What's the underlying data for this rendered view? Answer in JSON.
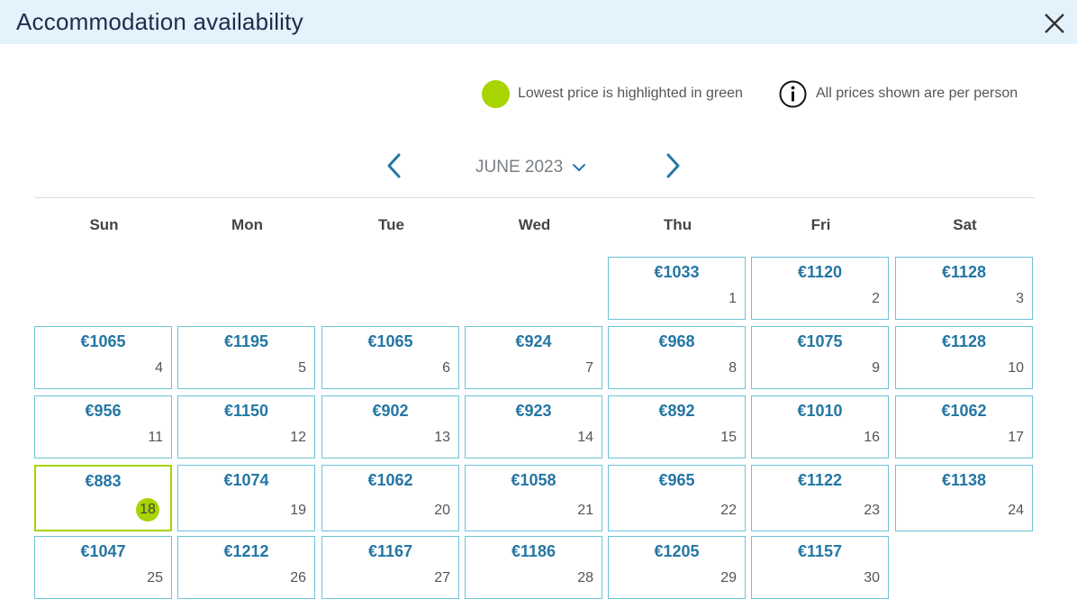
{
  "header": {
    "title": "Accommodation availability"
  },
  "legend": {
    "lowest_label": "Lowest price is highlighted in green",
    "info_label": "All prices shown are per person",
    "highlight_color": "#a8d400"
  },
  "calendar": {
    "month_label": "JUNE 2023",
    "weekdays": [
      "Sun",
      "Mon",
      "Tue",
      "Wed",
      "Thu",
      "Fri",
      "Sat"
    ],
    "first_weekday_index": 4,
    "lowest_day": 18,
    "days": [
      {
        "day": "1",
        "price": "€1033"
      },
      {
        "day": "2",
        "price": "€1120"
      },
      {
        "day": "3",
        "price": "€1128"
      },
      {
        "day": "4",
        "price": "€1065"
      },
      {
        "day": "5",
        "price": "€1195"
      },
      {
        "day": "6",
        "price": "€1065"
      },
      {
        "day": "7",
        "price": "€924"
      },
      {
        "day": "8",
        "price": "€968"
      },
      {
        "day": "9",
        "price": "€1075"
      },
      {
        "day": "10",
        "price": "€1128"
      },
      {
        "day": "11",
        "price": "€956"
      },
      {
        "day": "12",
        "price": "€1150"
      },
      {
        "day": "13",
        "price": "€902"
      },
      {
        "day": "14",
        "price": "€923"
      },
      {
        "day": "15",
        "price": "€892"
      },
      {
        "day": "16",
        "price": "€1010"
      },
      {
        "day": "17",
        "price": "€1062"
      },
      {
        "day": "18",
        "price": "€883"
      },
      {
        "day": "19",
        "price": "€1074"
      },
      {
        "day": "20",
        "price": "€1062"
      },
      {
        "day": "21",
        "price": "€1058"
      },
      {
        "day": "22",
        "price": "€965"
      },
      {
        "day": "23",
        "price": "€1122"
      },
      {
        "day": "24",
        "price": "€1138"
      },
      {
        "day": "25",
        "price": "€1047"
      },
      {
        "day": "26",
        "price": "€1212"
      },
      {
        "day": "27",
        "price": "€1167"
      },
      {
        "day": "28",
        "price": "€1186"
      },
      {
        "day": "29",
        "price": "€1205"
      },
      {
        "day": "30",
        "price": "€1157"
      }
    ]
  },
  "icons": {
    "close": "close-icon",
    "info": "info-icon",
    "prev": "chevron-left-icon",
    "next": "chevron-right-icon",
    "dropdown": "chevron-down-icon"
  }
}
